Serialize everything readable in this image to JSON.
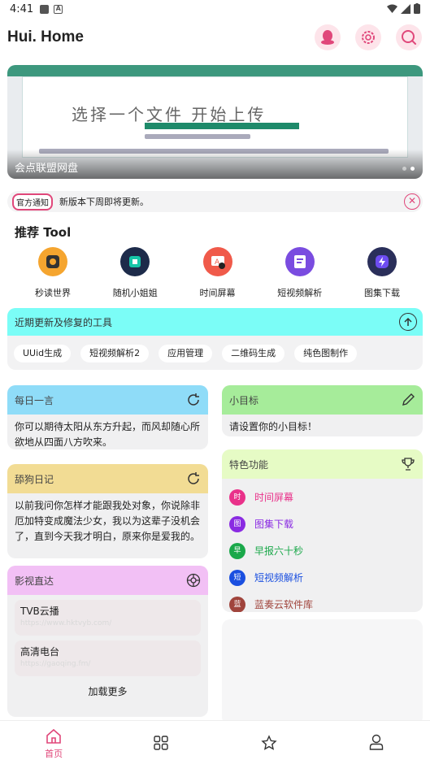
{
  "status_bar": {
    "time": "4:41"
  },
  "header": {
    "title": "Hui. Home",
    "icons": [
      "qq-icon",
      "settings-icon",
      "search-icon"
    ],
    "accent": "#e0477a"
  },
  "banner": {
    "caption": "会点联盟网盘",
    "doc_text": "选择一个文件 开始上传"
  },
  "notice": {
    "tag": "官方通知",
    "message": "新版本下周即将更新。"
  },
  "recommend": {
    "title": "推荐 Tool",
    "tools": [
      {
        "label": "秒读世界",
        "icon": "tool-icon",
        "color": "#f5a52f"
      },
      {
        "label": "随机小姐姐",
        "icon": "tool-icon",
        "color": "#16b5a0"
      },
      {
        "label": "时间屏幕",
        "icon": "tool-icon",
        "color": "#f05a4a"
      },
      {
        "label": "短视频解析",
        "icon": "tool-icon",
        "color": "#7a4ce0"
      },
      {
        "label": "图集下载",
        "icon": "tool-icon",
        "color": "#6d4cf0"
      }
    ]
  },
  "recent": {
    "title": "近期更新及修复的工具",
    "chips": [
      "UUid生成",
      "短视频解析2",
      "应用管理",
      "二维码生成",
      "纯色图制作"
    ]
  },
  "daily": {
    "title": "每日一言",
    "text": "你可以期待太阳从东方升起，而风却随心所欲地从四面八方吹来。"
  },
  "goal": {
    "title": "小目标",
    "text": "请设置你的小目标！"
  },
  "diary": {
    "title": "舔狗日记",
    "text": "以前我问你怎样才能跟我处对象，你说除非厄加特变成魔法少女，我以为这辈子没机会了，直到今天我才明白，原来你是爱我的。"
  },
  "features": {
    "title": "特色功能",
    "items": [
      {
        "glyph": "时",
        "label": "时间屏幕",
        "color": "#e9318a"
      },
      {
        "glyph": "图",
        "label": "图集下载",
        "color": "#8a2be2"
      },
      {
        "glyph": "早",
        "label": "早报六十秒",
        "color": "#1aa84a"
      },
      {
        "glyph": "短",
        "label": "短视频解析",
        "color": "#1a4fe0"
      },
      {
        "glyph": "蓝",
        "label": "蓝奏云软件库",
        "color": "#a0443c"
      }
    ]
  },
  "videos": {
    "title": "影视直达",
    "items": [
      {
        "name": "TVB云播",
        "url": "https://www.hktvyb.com/"
      },
      {
        "name": "高清电台",
        "url": "https://gaoqing.fm/"
      }
    ],
    "load_more": "加载更多"
  },
  "bottom_nav": {
    "home": "首页"
  }
}
